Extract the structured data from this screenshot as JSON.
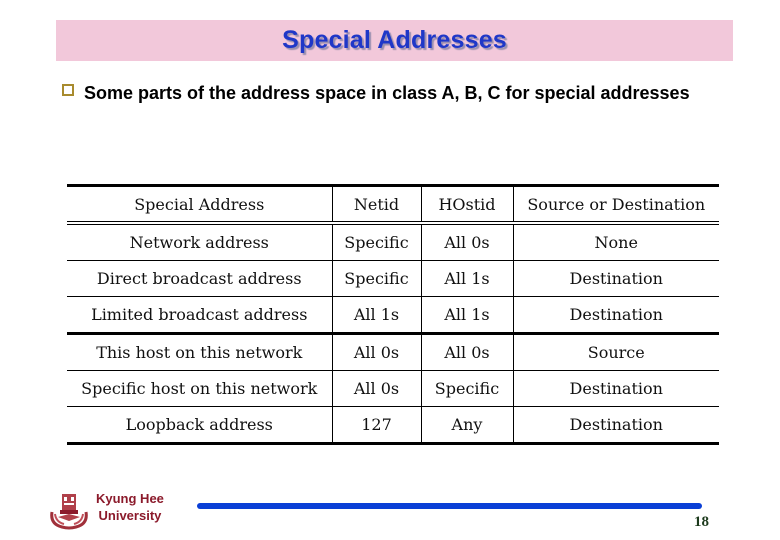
{
  "slide": {
    "title": "Special Addresses",
    "bullet": "Some parts of the address space in class A, B, C for special addresses",
    "bullet_icon": "hollow-square-bullet"
  },
  "table": {
    "headers": [
      "Special Address",
      "Netid",
      "HOstid",
      "Source or Destination"
    ],
    "rows": [
      [
        "Network address",
        "Specific",
        "All 0s",
        "None"
      ],
      [
        "Direct broadcast address",
        "Specific",
        "All 1s",
        "Destination"
      ],
      [
        "Limited broadcast address",
        "All 1s",
        "All 1s",
        "Destination"
      ],
      [
        "This host on this network",
        "All 0s",
        "All 0s",
        "Source"
      ],
      [
        "Specific host on this network",
        "All 0s",
        "Specific",
        "Destination"
      ],
      [
        "Loopback address",
        "127",
        "Any",
        "Destination"
      ]
    ]
  },
  "footer": {
    "logo_icon": "university-crest-icon",
    "university_line1": "Kyung Hee",
    "university_line2": "University",
    "page_number": "18"
  },
  "colors": {
    "title_bg": "#f2c8da",
    "title_text": "#1f37c8",
    "footer_line": "#0a3fd6",
    "university_text": "#8b1a2b"
  }
}
